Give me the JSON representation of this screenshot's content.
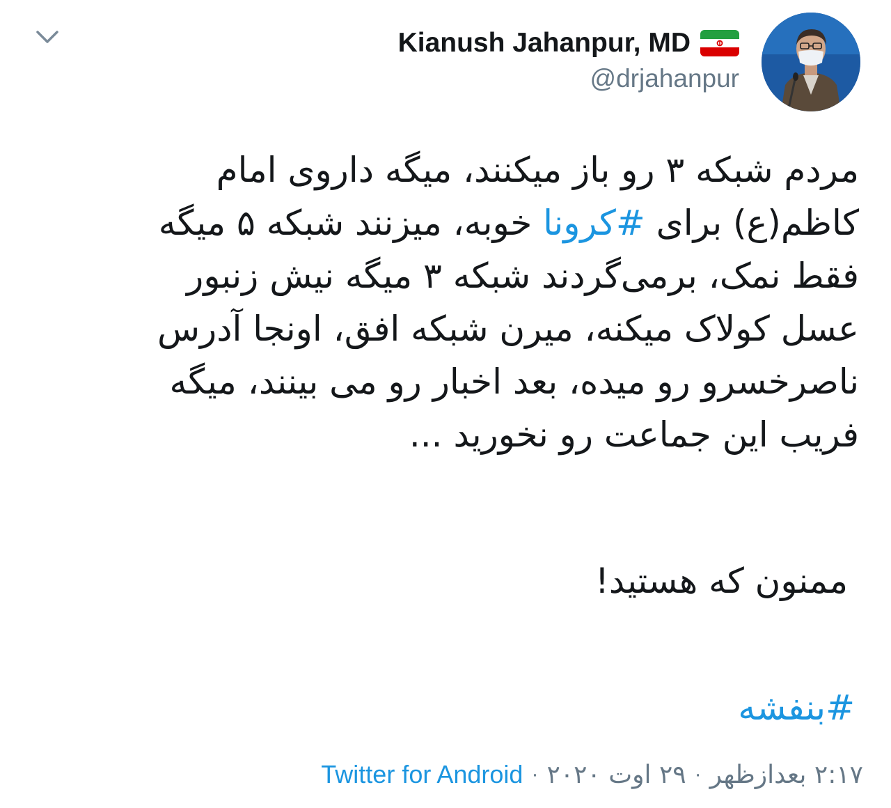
{
  "header": {
    "display_name": "Kianush Jahanpur, MD",
    "handle": "@drjahanpur",
    "flag_icon": "iran-flag-icon",
    "avatar": "profile-photo",
    "chevron_icon": "chevron-down-icon"
  },
  "tweet": {
    "lines": [
      "مردم شبکه ۳ رو باز میکنند، میگه داروی امام",
      "میگه",
      "فقط نمک، برمی‌گردند شبکه ۳ میگه نیش زنبور",
      "عسل کولاک میکنه، میرن شبکه افق، اونجا آدرس",
      "ناصرخسرو رو میده،  بعد اخبار رو می بینند، میگه",
      "فریب این جماعت رو نخورید ..."
    ],
    "line2_before": "کاظم(ع) برای ",
    "line2_hashtag": "#کرونا",
    "line2_after": " خوبه، میزنند شبکه ۵ ",
    "thanks": "ممنون که هستید!",
    "hashtag": "#بنفشه"
  },
  "meta": {
    "time": "۲:۱۷ بعدازظهر",
    "date": "۲۹ اوت ۲۰۲۰",
    "separator": "·",
    "source": "Twitter for Android"
  },
  "colors": {
    "link": "#1b95e0",
    "secondary": "#657786",
    "text": "#14171a"
  }
}
